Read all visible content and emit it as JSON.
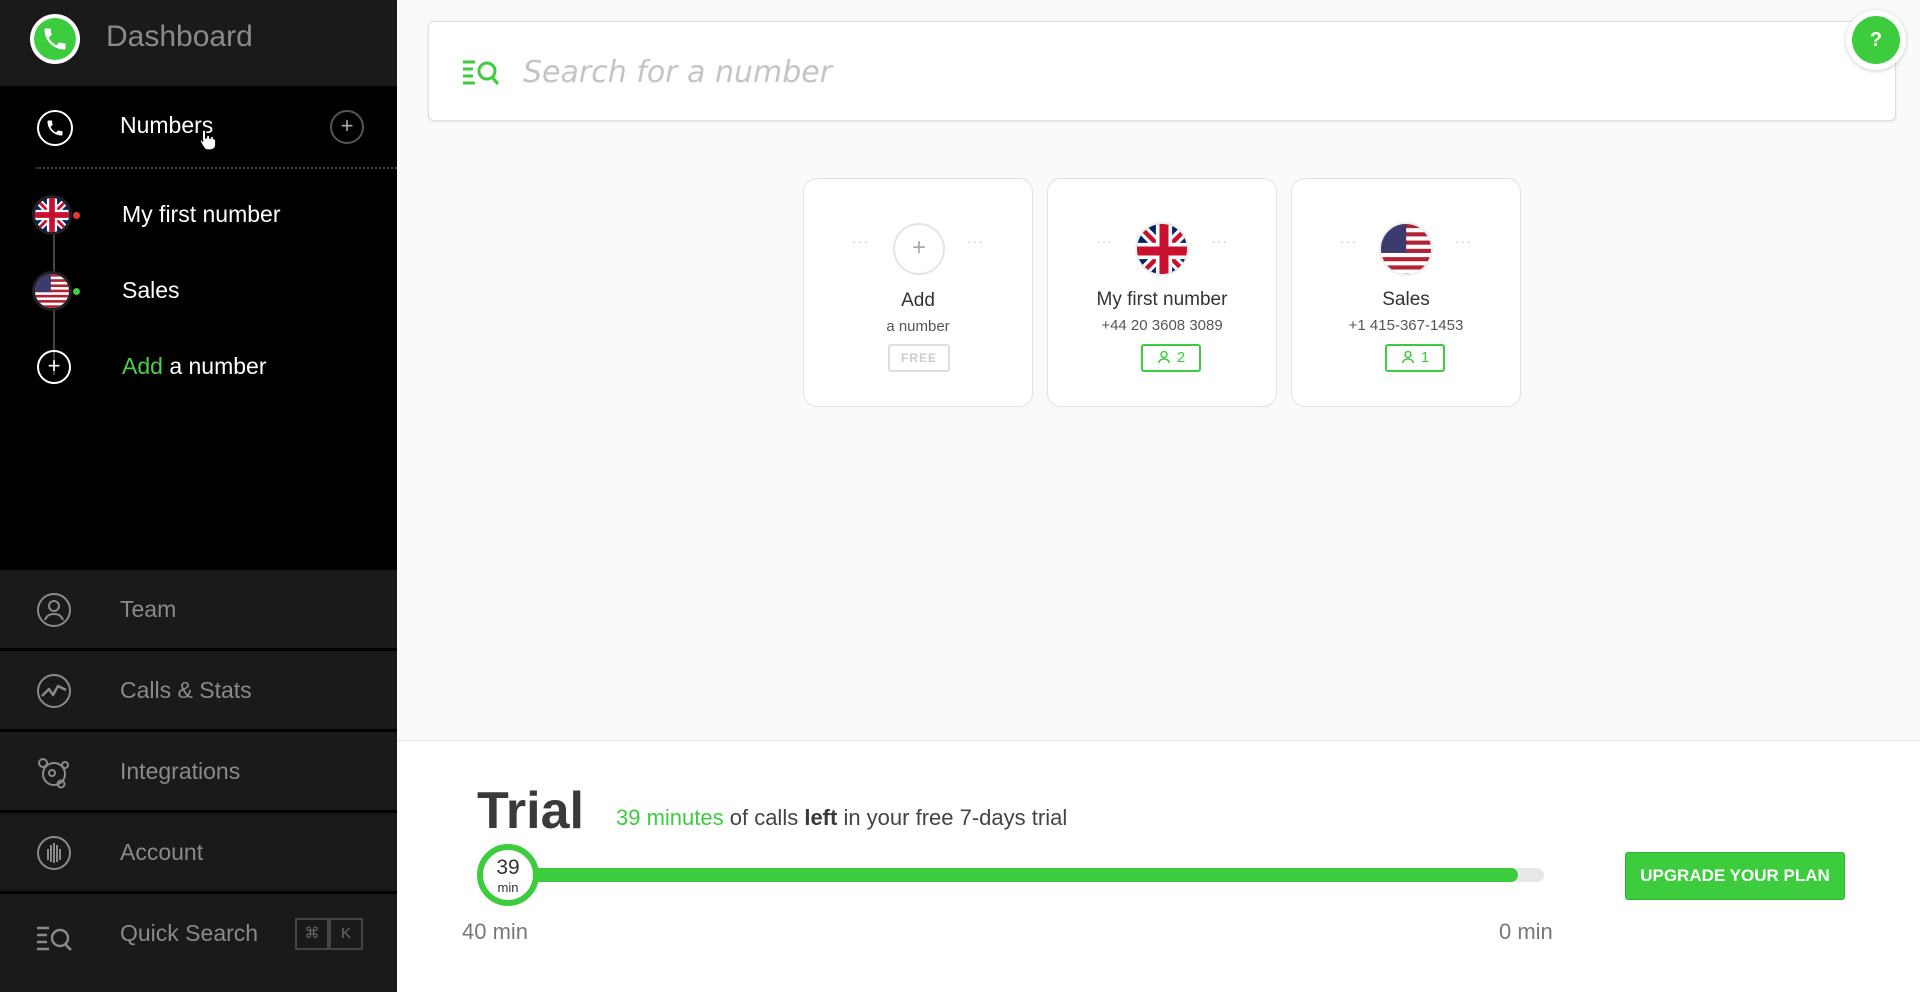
{
  "colors": {
    "accent": "#3dcc3d",
    "sidebar_bg": "#000000",
    "sidebar_nav_bg": "#1a1a1a"
  },
  "sidebar": {
    "title": "Dashboard",
    "numbers": {
      "label": "Numbers",
      "add_icon": "plus-icon"
    },
    "number_items": [
      {
        "label": "My first number",
        "flag": "uk-flag-icon",
        "status_color": "#e53935"
      },
      {
        "label": "Sales",
        "flag": "us-flag-icon",
        "status_color": "#3dcc3d"
      }
    ],
    "add_number": {
      "highlight": "Add",
      "rest": " a number"
    },
    "nav": [
      {
        "label": "Team",
        "icon": "user-circle-icon"
      },
      {
        "label": "Calls & Stats",
        "icon": "stats-icon"
      },
      {
        "label": "Integrations",
        "icon": "integrations-icon"
      },
      {
        "label": "Account",
        "icon": "account-icon"
      },
      {
        "label": "Quick Search",
        "icon": "quick-search-icon",
        "shortcut": [
          "⌘",
          "K"
        ]
      }
    ]
  },
  "search": {
    "placeholder": "Search for a number",
    "value": ""
  },
  "help": {
    "label": "?"
  },
  "cards": {
    "add": {
      "title": "Add",
      "subtitle": "a number",
      "badge": "FREE",
      "dots": "···"
    },
    "numbers": [
      {
        "title": "My first number",
        "phone": "+44 20 3608 3089",
        "members": "2",
        "flag": "uk-flag-icon",
        "dots": "···"
      },
      {
        "title": "Sales",
        "phone": "+1 415-367-1453",
        "members": "1",
        "flag": "us-flag-icon",
        "dots": "···"
      }
    ]
  },
  "trial": {
    "title": "Trial",
    "minutes_text": "39 minutes",
    "desc_mid": " of calls ",
    "desc_bold": "left",
    "desc_end": " in your free 7-days trial",
    "remaining_value": "39",
    "remaining_unit": "min",
    "progress_fraction": 0.975,
    "range_start": "40 min",
    "range_end": "0 min",
    "upgrade_label": "UPGRADE YOUR PLAN"
  }
}
